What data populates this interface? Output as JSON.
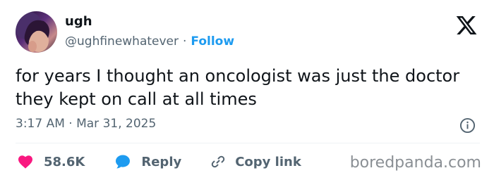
{
  "author": {
    "display_name": "ugh",
    "handle": "@ughfinewhatever",
    "separator": "·",
    "follow_label": "Follow"
  },
  "tweet": {
    "text": "for years I thought an oncologist was just the doctor they kept on call at all times",
    "timestamp": "3:17 AM · Mar 31, 2025"
  },
  "actions": {
    "like_count": "58.6K",
    "reply_label": "Reply",
    "copy_link_label": "Copy link"
  },
  "icons": {
    "platform": "x-logo-icon",
    "info": "info-icon",
    "like": "heart-icon",
    "reply": "speech-bubble-icon",
    "copy": "link-icon"
  },
  "watermark": "boredpanda.com",
  "colors": {
    "text": "#0f1419",
    "secondary": "#536471",
    "link_blue": "#1d9bf0",
    "heart_pink": "#f91880",
    "reply_blue": "#1d9bf0",
    "watermark": "#8a8f94"
  }
}
